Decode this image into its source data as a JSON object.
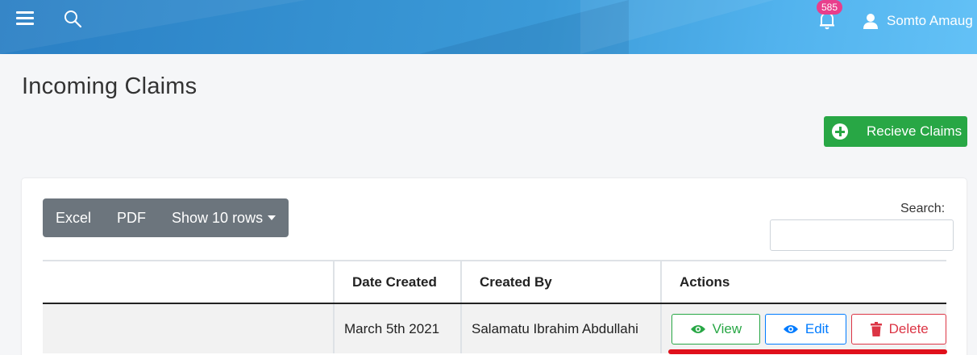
{
  "header": {
    "notification_count": "585",
    "user_name": "Somto Amaug"
  },
  "page": {
    "title": "Incoming Claims",
    "receive_button": "Recieve Claims"
  },
  "toolbar": {
    "excel": "Excel",
    "pdf": "PDF",
    "show_rows": "Show 10 rows",
    "search_label": "Search:",
    "search_value": ""
  },
  "table": {
    "columns": [
      "",
      "Date Created",
      "Created By",
      "Actions"
    ],
    "rows": [
      {
        "first": "",
        "date_created": "March 5th 2021",
        "created_by": "Salamatu Ibrahim Abdullahi",
        "actions": {
          "view": "View",
          "edit": "Edit",
          "delete": "Delete"
        }
      }
    ]
  },
  "colors": {
    "header_gradient_start": "#2a7fc4",
    "header_gradient_end": "#63c1f6",
    "success": "#28a745",
    "primary": "#007bff",
    "danger": "#dc3545",
    "badge": "#e83e8c",
    "annotation": "#e0101b"
  },
  "icons": {
    "menu": "hamburger-icon",
    "search": "search-icon",
    "bell": "bell-icon",
    "user": "user-icon",
    "receive": "plus-circle-icon",
    "view": "eye-icon",
    "edit": "eye-icon",
    "delete": "trash-icon"
  }
}
